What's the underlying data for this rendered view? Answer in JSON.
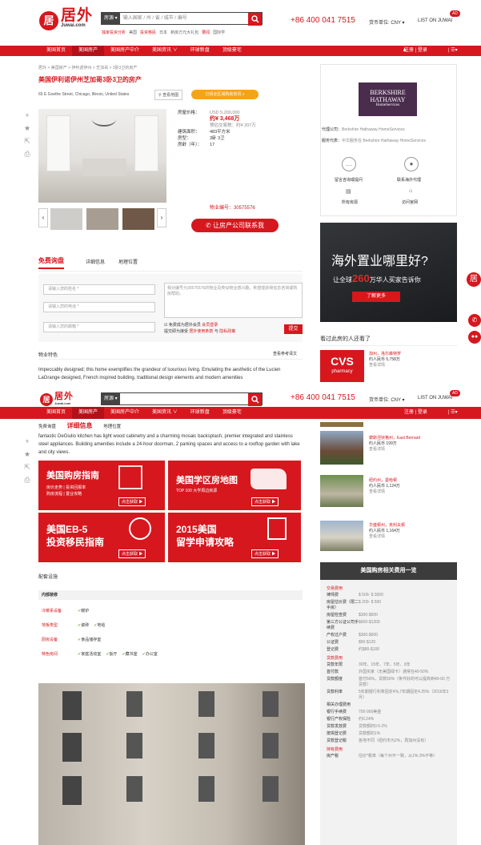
{
  "header": {
    "logo_mark": "居",
    "logo_cn": "居外",
    "logo_en": "Juwai.com",
    "search_select": "房源 ▾",
    "search_placeholder": "输入国家 / 州 / 省 / 城市 / 编号",
    "sublinks": [
      "独家投资分析",
      "美国",
      "投资移民",
      "日本",
      "新房万元大礼包",
      "要闻",
      "国际学"
    ],
    "phone": "+86 400 041 7515",
    "currency": "货币单位: CNY ▾",
    "list_on": "LIST ON JUWAI",
    "badge": "AD"
  },
  "nav": {
    "items": [
      "美国首页",
      "美国房产",
      "美国房产中介",
      "美国资讯 ∨",
      "环球新盘",
      "顶级豪宅"
    ],
    "active_index": 1,
    "right": "注册 | 登录"
  },
  "breadcrumb": "居外 > 美国房产 > 伊利诺伊州 > 芝加哥 > 3卧3卫的房产",
  "listing": {
    "title": "美国伊利诺伊州芝加哥3卧3卫的房产",
    "address": "65 E Goethe Street, Chicago, Illinois, United States",
    "map_button": "查看地图",
    "promo": "订阅全区域购房资讯 »",
    "price_label": "房屋价格：",
    "price_usd": "USD 5,200,000",
    "price_cny_1": "约¥ 3,468万",
    "price_cny_2": "预估交易税：约¥ 207万",
    "area_label": "建筑面积：",
    "area": "483平方米",
    "rooms_label": "房型：",
    "rooms": "3卧 3卫",
    "year_label": "房龄（年）：",
    "year": "17",
    "property_id": "物业编号：30575576",
    "contact_button": "让房产公司联系我"
  },
  "agent": {
    "logo_line1": "BERKSHIRE",
    "logo_line2": "HATHAWAY",
    "logo_line3": "HomeServices",
    "company_label": "代理公司：",
    "company": "Berkshire Hathaway HomeServices",
    "service_label": "服务代表：",
    "service": "中文服务在 Berkshire Hathaway HomeServices",
    "actions": [
      "留言咨询或提问",
      "联系海外代理",
      "所有房源",
      "访问官网"
    ]
  },
  "ad": {
    "line1": "海外置业哪里好?",
    "line2": "让全球",
    "num": "260",
    "line3": "万华人买家告诉你",
    "button": "了解更多"
  },
  "tabs": [
    "免费询盘",
    "详细信息",
    "地理位置"
  ],
  "form": {
    "name": "请输入您的姓名 *",
    "phone": "请输入您的电话 *",
    "email": "请输入您的邮箱 *",
    "message": "我对编号为30575576的物业及类似物业感兴趣，希望能获得信息咨询或购房帮助。",
    "check": "免费成为居外会员",
    "check_link": "会员登录",
    "terms": "提交即为接受",
    "terms_link1": "居外使用条款",
    "terms_and": "与",
    "terms_link2": "隐私政策",
    "submit": "提交"
  },
  "features": {
    "title": "物业特色",
    "translate": "查看参考译文",
    "text1": "Impeccably designed; this home exemplifies the grandeur of luxurious living. Emulating the aesthetic of the Lucien LaGrange designed, French inspired building, traditional design elements and modern amenities",
    "text2": "fantastic DeGiulio kitchen has light wood cabinetry and a charming mosaic backsplash, premier integrated and stainless steel appliances. Building amenities include a 24-hour doorman, 2 parking spaces and access to a rooftop garden with lake and city views."
  },
  "also_viewed": {
    "title": "看过此房的人还看了",
    "items": [
      {
        "name": "加州，洛尔森特罗",
        "price": "约人民币 5,758万",
        "link": "查看详情"
      },
      {
        "name": "康斯涅狄格州，East Bernard",
        "price": "约人民币 199万",
        "link": "查看详情"
      },
      {
        "name": "纽约州，曼哈顿",
        "price": "约人民币 1,124万",
        "link": "查看详情"
      },
      {
        "name": "华盛顿州，克利夫顿",
        "price": "约人民币 1,164万",
        "link": "查看详情"
      }
    ],
    "cvs": "CVS",
    "cvs_sub": "pharmacy"
  },
  "guides": [
    {
      "title": "美国购房指南",
      "sub1": "房价走势 | 投资回报率",
      "sub2": "购房流程 | 置业攻略",
      "btn": "点击获取 ▶"
    },
    {
      "title": "美国学区房地图",
      "sub1": "TOP 100 大学周边房源",
      "sub2": "",
      "btn": "点击获取 ▶"
    },
    {
      "title": "美国EB-5",
      "title2": "投资移民指南",
      "btn": "点击获取 ▶"
    },
    {
      "title": "2015美国",
      "title2": "留学申请攻略",
      "btn": "点击获取 ▶"
    }
  ],
  "amenities": {
    "title": "配套设施",
    "section": "内部装修",
    "rows": [
      {
        "label": "冷暖系设备",
        "items": [
          "暖炉"
        ]
      },
      {
        "label": "地板类型",
        "items": [
          "瓷砖",
          "地毯"
        ]
      },
      {
        "label": "厨房设备",
        "items": [
          "食品储存室"
        ]
      },
      {
        "label": "特色房间",
        "items": [
          "家庭活动室",
          "饭厅",
          "藏书室",
          "办公室"
        ]
      }
    ]
  },
  "fees": {
    "title": "美国购房相关费用一览",
    "sections": [
      {
        "name": "交易费用",
        "rows": [
          [
            "律师费",
            "$ 500- $ 3000"
          ],
          [
            "房屋估价费（限二手房）",
            "$ 200- $ 500"
          ],
          [
            "房屋检查费",
            "$300-$500"
          ],
          [
            "第三方公证公司手续费",
            "$600-$1200"
          ],
          [
            "产权过户费",
            "$300-$600"
          ],
          [
            "公证费",
            "$50-$120"
          ],
          [
            "登记费",
            "约$80-$100"
          ]
        ]
      },
      {
        "name": "贷款费用",
        "rows": [
          [
            "贷款年限",
            "30年、15年、7年、5年、3年"
          ],
          [
            "首付款",
            "外国买家（无美国绿卡）通常在40-50%"
          ],
          [
            "贷款额度",
            "首付50%，贷款50%（条件好的可以提高到40-60 万贷款）"
          ],
          [
            "贷款利率",
            "5年期银行利率固定4%,7年期固定4.25%（2016年3月）"
          ],
          [
            "相关办理费用",
            ""
          ],
          [
            "银行手续费",
            "700-900美金"
          ],
          [
            "银行产权保险",
            "约0.24%"
          ],
          [
            "贷款发放费",
            "贷款额的0.5-2%"
          ],
          [
            "按揭登记费",
            "贷款额的1%"
          ],
          [
            "贷款登记税",
            "各地不同（纽约市为2%，周加州没有）"
          ]
        ]
      },
      {
        "name": "持有费用",
        "rows": [
          [
            "房产税",
            "估价*税率（每个州不一致，从1%-3%不等）"
          ]
        ]
      }
    ]
  },
  "colors": {
    "brand": "#d6171e",
    "dark_nav": "#b4101a",
    "fee_header": "#3c3c3c"
  }
}
